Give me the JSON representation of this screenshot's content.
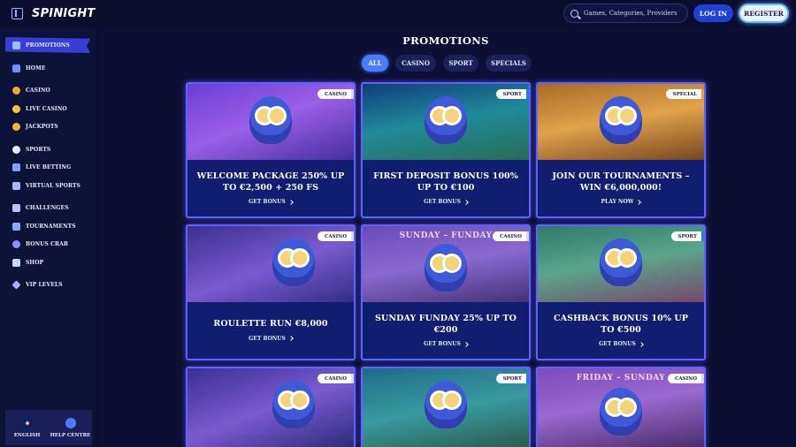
{
  "header": {
    "logo_text": "SPINIGHT",
    "search_placeholder": "Games, Categories, Providers",
    "login_label": "LOG IN",
    "register_label": "REGISTER"
  },
  "sidebar": {
    "items": [
      {
        "label": "PROMOTIONS",
        "icon": "gift-icon",
        "active": true
      },
      {
        "label": "HOME",
        "icon": "home-icon"
      },
      {
        "label": "CASINO",
        "icon": "casino-icon"
      },
      {
        "label": "LIVE CASINO",
        "icon": "live-casino-icon"
      },
      {
        "label": "JACKPOTS",
        "icon": "jackpot-icon"
      },
      {
        "label": "SPORTS",
        "icon": "football-icon"
      },
      {
        "label": "LIVE BETTING",
        "icon": "live-betting-icon"
      },
      {
        "label": "VIRTUAL SPORTS",
        "icon": "virtual-sports-icon"
      },
      {
        "label": "CHALLENGES",
        "icon": "challenges-icon"
      },
      {
        "label": "TOURNAMENTS",
        "icon": "trophy-icon"
      },
      {
        "label": "BONUS CRAB",
        "icon": "crab-icon"
      },
      {
        "label": "SHOP",
        "icon": "shop-icon"
      },
      {
        "label": "VIP LEVELS",
        "icon": "diamond-icon"
      }
    ],
    "footer": {
      "language_label": "ENGLISH",
      "help_label": "HELP CENTRE"
    }
  },
  "main": {
    "title": "PROMOTIONS",
    "filters": [
      {
        "label": "ALL",
        "active": true
      },
      {
        "label": "CASINO"
      },
      {
        "label": "SPORT"
      },
      {
        "label": "SPECIALS"
      }
    ],
    "cards": [
      {
        "tag": "CASINO",
        "title": "WELCOME PACKAGE 250% UP TO €2,500 + 250 FS",
        "cta": "GET BONUS"
      },
      {
        "tag": "SPORT",
        "title": "FIRST DEPOSIT BONUS 100% UP TO €100",
        "cta": "GET BONUS"
      },
      {
        "tag": "SPECIAL",
        "title": "JOIN OUR TOURNAMENTS – WIN €6,000,000!",
        "cta": "PLAY NOW"
      },
      {
        "tag": "CASINO",
        "title": "ROULETTE RUN €8,000",
        "cta": "GET BONUS"
      },
      {
        "tag": "CASINO",
        "title": "SUNDAY FUNDAY 25% UP TO €200",
        "cta": "GET BONUS",
        "art_text": "SUNDAY – FUNDAY"
      },
      {
        "tag": "SPORT",
        "title": "CASHBACK BONUS 10% UP TO €500",
        "cta": "GET BONUS"
      },
      {
        "tag": "CASINO",
        "title": "",
        "cta": ""
      },
      {
        "tag": "SPORT",
        "title": "",
        "cta": ""
      },
      {
        "tag": "CASINO",
        "title": "",
        "cta": "",
        "art_text": "FRIDAY – SUNDAY"
      }
    ]
  },
  "colors": {
    "background": "#0c0f33",
    "accent_blue": "#1f3fd8",
    "card_border": "#5c63ff",
    "active_nav": "#3a3cd6"
  }
}
